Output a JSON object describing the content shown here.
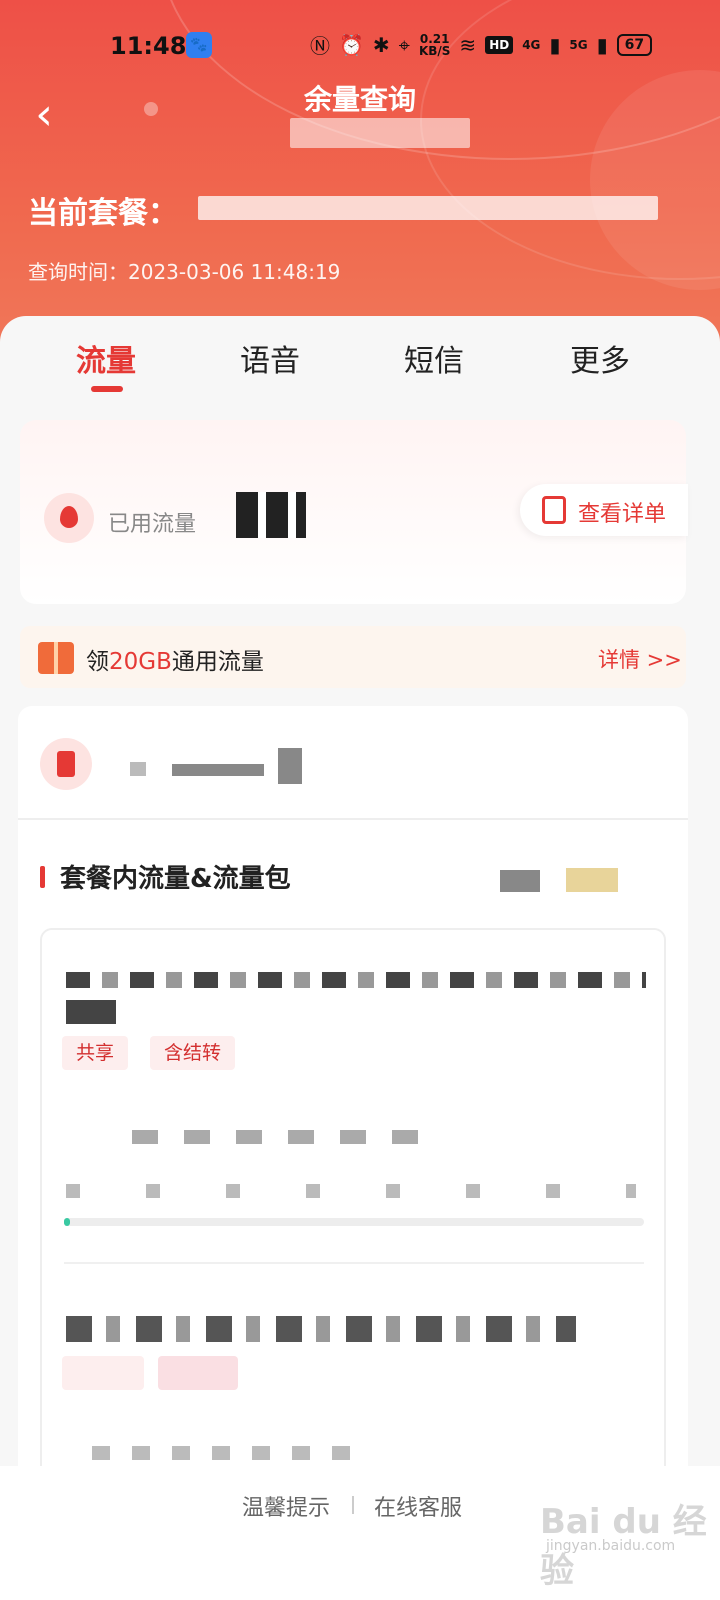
{
  "status_bar": {
    "time": "11:48",
    "app_icon": "baidu-paw-icon",
    "net_speed": "0.21\nKB/S",
    "hd_badge": "HD",
    "net_4g": "4G",
    "net_5g": "5G",
    "battery": "67"
  },
  "header": {
    "title": "余量查询",
    "plan_label": "当前套餐：",
    "query_time": "查询时间：2023-03-06 11:48:19"
  },
  "tabs": [
    {
      "label": "流量",
      "active": true
    },
    {
      "label": "语音",
      "active": false
    },
    {
      "label": "短信",
      "active": false
    },
    {
      "label": "更多",
      "active": false
    }
  ],
  "usage": {
    "label": "已用流量",
    "detail_button": "查看详单"
  },
  "promo": {
    "prefix": "领",
    "highlight": "20GB",
    "suffix": "通用流量",
    "link": "详情 >>"
  },
  "section": {
    "title": "套餐内流量&流量包"
  },
  "package_tags": [
    "共享",
    "含结转"
  ],
  "package_progress_fraction": 0.01,
  "footer": {
    "tips": "温馨提示",
    "service": "在线客服"
  },
  "watermark": {
    "main": "Bai du 经验",
    "sub": "jingyan.baidu.com"
  },
  "colors": {
    "accent": "#e53935",
    "progress": "#39c9a2"
  }
}
